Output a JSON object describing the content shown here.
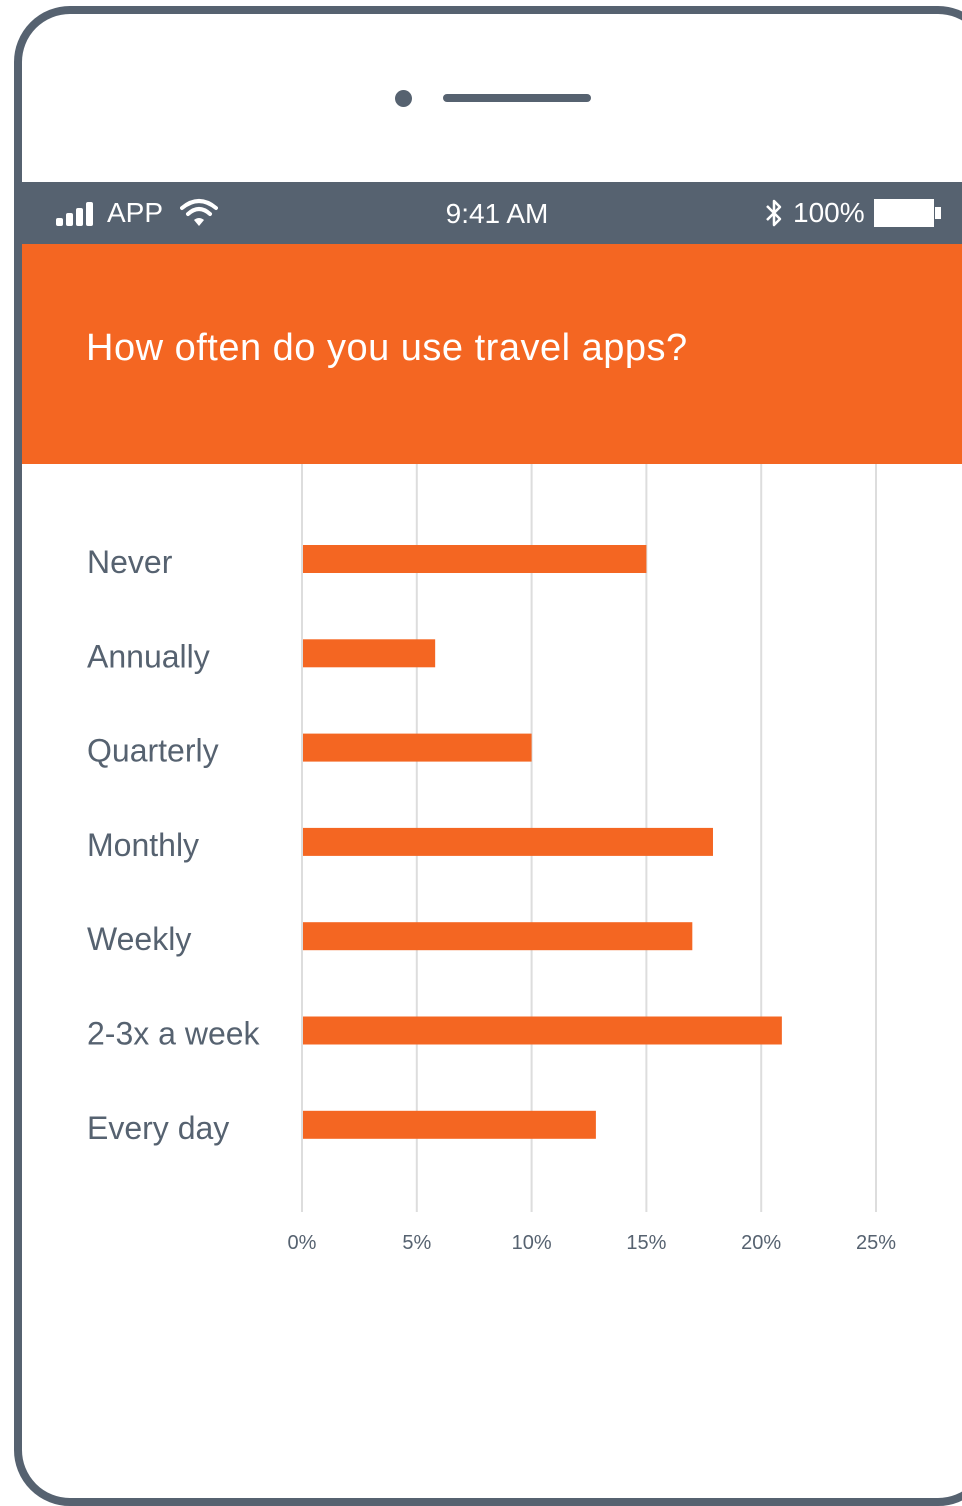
{
  "status_bar": {
    "carrier": "APP",
    "time": "9:41 AM",
    "battery": "100%"
  },
  "icons": {
    "signal": "signal-bars-icon",
    "wifi": "wifi-icon",
    "bluetooth": "bluetooth-icon",
    "battery": "battery-icon"
  },
  "colors": {
    "accent": "#f46622",
    "frame": "#566270",
    "label_text": "#566270",
    "grid": "#dddddd"
  },
  "header": {
    "title": "How often do you use travel apps?"
  },
  "chart_data": {
    "type": "bar",
    "orientation": "horizontal",
    "title": "",
    "categories": [
      "Never",
      "Annually",
      "Quarterly",
      "Monthly",
      "Weekly",
      "2-3x a week",
      "Every day"
    ],
    "values": [
      15,
      5.8,
      10,
      17.9,
      17,
      20.9,
      12.8
    ],
    "xlim": [
      0,
      25
    ],
    "xticks": [
      0,
      5,
      10,
      15,
      20,
      25
    ],
    "xtick_labels": [
      "0%",
      "5%",
      "10%",
      "15%",
      "20%",
      "25%"
    ],
    "xlabel": "",
    "ylabel": "",
    "grid": "vertical"
  }
}
